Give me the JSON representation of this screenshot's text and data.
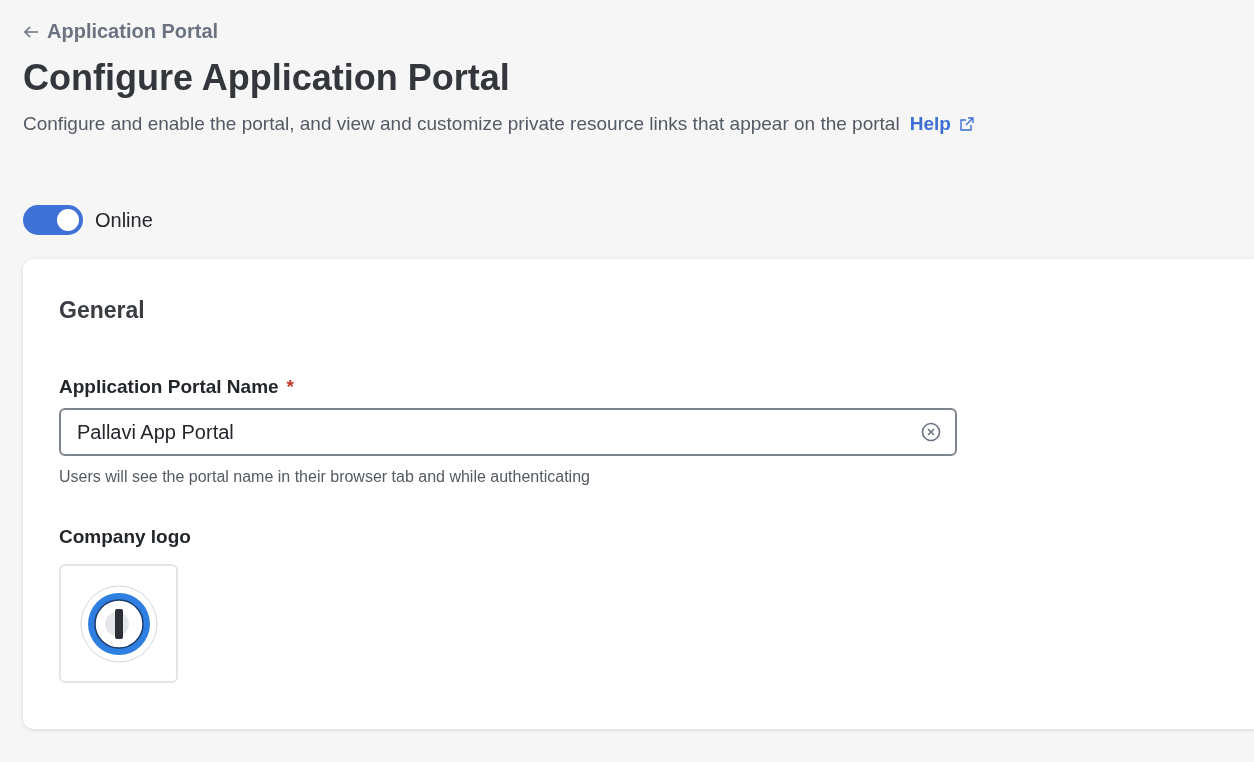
{
  "breadcrumb": {
    "label": "Application Portal"
  },
  "page": {
    "title": "Configure Application Portal",
    "description": "Configure and enable the portal, and view and customize private resource links that appear on the portal",
    "help_link": "Help"
  },
  "status_toggle": {
    "label": "Online",
    "on": true
  },
  "general": {
    "heading": "General",
    "name_field": {
      "label": "Application Portal Name",
      "required_mark": "*",
      "value": "Pallavi App Portal",
      "hint": "Users will see the portal name in their browser tab and while authenticating"
    },
    "logo": {
      "label": "Company logo"
    }
  }
}
